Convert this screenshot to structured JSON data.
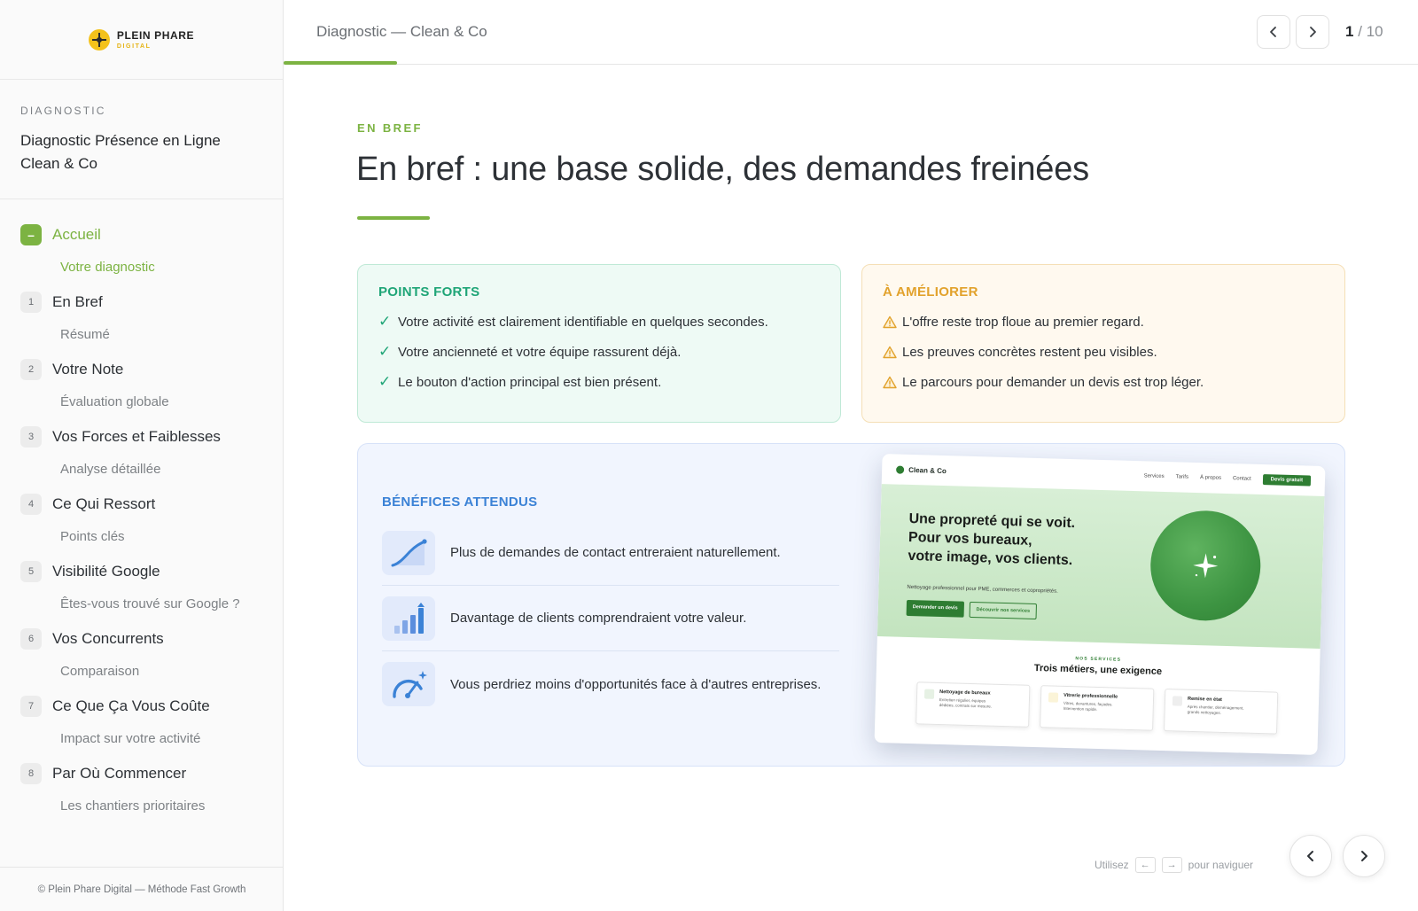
{
  "brand": {
    "name": "PLEIN PHARE",
    "sub": "DIGITAL"
  },
  "doc": {
    "eyebrow": "DIAGNOSTIC",
    "title_line1": "Diagnostic Présence en Ligne",
    "title_line2": "Clean & Co"
  },
  "nav": [
    {
      "num": "–",
      "label": "Accueil",
      "sub": "Votre diagnostic",
      "active": true
    },
    {
      "num": "1",
      "label": "En Bref",
      "sub": "Résumé"
    },
    {
      "num": "2",
      "label": "Votre Note",
      "sub": "Évaluation globale"
    },
    {
      "num": "3",
      "label": "Vos Forces et Faiblesses",
      "sub": "Analyse détaillée"
    },
    {
      "num": "4",
      "label": "Ce Qui Ressort",
      "sub": "Points clés"
    },
    {
      "num": "5",
      "label": "Visibilité Google",
      "sub": "Êtes-vous trouvé sur Google ?"
    },
    {
      "num": "6",
      "label": "Vos Concurrents",
      "sub": "Comparaison"
    },
    {
      "num": "7",
      "label": "Ce Que Ça Vous Coûte",
      "sub": "Impact sur votre activité"
    },
    {
      "num": "8",
      "label": "Par Où Commencer",
      "sub": "Les chantiers prioritaires"
    }
  ],
  "footer": "© Plein Phare Digital — Méthode Fast Growth",
  "topbar": {
    "title": "Diagnostic — Clean & Co",
    "current_page": "1",
    "total_pages": "/ 10",
    "progress": 0.1
  },
  "section": {
    "eyebrow": "EN BREF",
    "title": "En bref : une base solide, des demandes freinées"
  },
  "strengths": {
    "title": "POINTS FORTS",
    "items": [
      "Votre activité est clairement identifiable en quelques secondes.",
      "Votre ancienneté et votre équipe rassurent déjà.",
      "Le bouton d'action principal est bien présent."
    ]
  },
  "improvements": {
    "title": "À AMÉLIORER",
    "items": [
      "L'offre reste trop floue au premier regard.",
      "Les preuves concrètes restent peu visibles.",
      "Le parcours pour demander un devis est trop léger."
    ]
  },
  "benefits": {
    "title": "BÉNÉFICES ATTENDUS",
    "items": [
      "Plus de demandes de contact entreraient naturellement.",
      "Davantage de clients comprendraient votre valeur.",
      "Vous perdriez moins d'opportunités face à d'autres entreprises."
    ]
  },
  "mockup": {
    "brand": "Clean & Co",
    "links": [
      "Services",
      "Tarifs",
      "À propos",
      "Contact"
    ],
    "cta": "Devis gratuit",
    "hero_line1": "Une propreté qui se voit.",
    "hero_line2": "Pour vos bureaux,",
    "hero_line3": "votre image, vos clients.",
    "hero_sub": "Nettoyage professionnel pour PME, commerces et copropriétés.",
    "btn_primary": "Demander un devis",
    "btn_secondary": "Découvrir nos services",
    "services_eyebrow": "NOS SERVICES",
    "services_title": "Trois métiers, une exigence",
    "cards": [
      {
        "title": "Nettoyage de bureaux",
        "desc1": "Entretien régulier, équipes",
        "desc2": "dédiées, contrats sur mesure."
      },
      {
        "title": "Vitrerie professionnelle",
        "desc1": "Vitres, devantures, façades.",
        "desc2": "Intervention rapide."
      },
      {
        "title": "Remise en état",
        "desc1": "Après chantier, déménagement,",
        "desc2": "grands nettoyages."
      }
    ]
  },
  "hint": {
    "prefix": "Utilisez",
    "key_left": "←",
    "key_right": "→",
    "suffix": "pour naviguer"
  },
  "colors": {
    "accent": "#7cb342",
    "success": "#1fa577",
    "warning": "#e2a22c",
    "info": "#3b82d6"
  }
}
